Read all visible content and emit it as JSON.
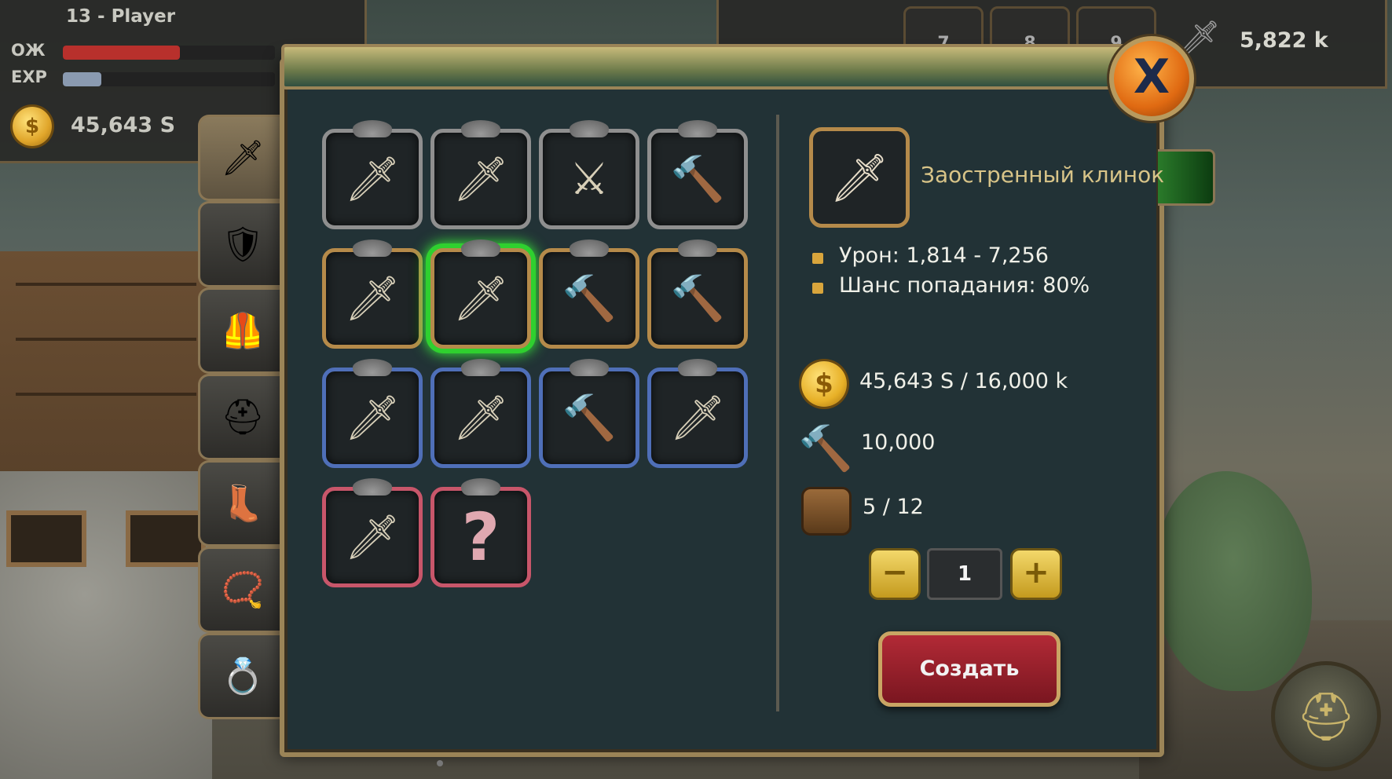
{
  "hud": {
    "player_name": "13 - Player",
    "hp_label": "ОЖ",
    "exp_label": "EXP",
    "hp_fill": 0.55,
    "exp_fill": 0.18,
    "gold": "45,643 S",
    "coin_symbol": "$",
    "right_tabs": [
      "7",
      "8",
      "9"
    ],
    "right_value": "5,822 k"
  },
  "colors": {
    "hp": "#b8302c",
    "exp": "#8a9ab0",
    "selected_glow": "#2fd02f",
    "create_button": "#b22a36"
  },
  "sidebar": {
    "categories": [
      {
        "name": "weapon",
        "icon": "🗡",
        "active": true
      },
      {
        "name": "shield",
        "icon": "🛡",
        "active": false
      },
      {
        "name": "armor",
        "icon": "🦺",
        "active": false
      },
      {
        "name": "helmet",
        "icon": "⛑",
        "active": false
      },
      {
        "name": "boots",
        "icon": "👢",
        "active": false
      },
      {
        "name": "amulet",
        "icon": "📿",
        "active": false
      },
      {
        "name": "ring",
        "icon": "💍",
        "active": false
      }
    ]
  },
  "panel": {
    "close_icon": "X",
    "items": [
      {
        "icon": "🗡",
        "rarity": "grey",
        "selected": false
      },
      {
        "icon": "🗡",
        "rarity": "grey",
        "selected": false
      },
      {
        "icon": "⚔",
        "rarity": "grey",
        "selected": false
      },
      {
        "icon": "🔨",
        "rarity": "grey",
        "selected": false
      },
      {
        "icon": "🗡",
        "rarity": "gold",
        "selected": false
      },
      {
        "icon": "🗡",
        "rarity": "gold",
        "selected": true
      },
      {
        "icon": "🔨",
        "rarity": "gold",
        "selected": false
      },
      {
        "icon": "🔨",
        "rarity": "gold",
        "selected": false
      },
      {
        "icon": "🗡",
        "rarity": "blue",
        "selected": false
      },
      {
        "icon": "🗡",
        "rarity": "blue",
        "selected": false
      },
      {
        "icon": "🔨",
        "rarity": "blue",
        "selected": false
      },
      {
        "icon": "🗡",
        "rarity": "blue",
        "selected": false
      },
      {
        "icon": "🗡",
        "rarity": "red",
        "selected": false
      },
      {
        "icon": "?",
        "rarity": "red",
        "selected": false
      }
    ]
  },
  "details": {
    "item_name": "Заостренный клинок",
    "item_icon": "🗡",
    "damage": "Урон: 1,814 - 7,256",
    "hit_chance": "Шанс попадания: 80%",
    "cost": "45,643 S / 16,000 k",
    "craft_points": "10,000",
    "inventory": "5 / 12",
    "quantity": "1",
    "minus": "−",
    "plus": "+",
    "create_label": "Создать"
  }
}
